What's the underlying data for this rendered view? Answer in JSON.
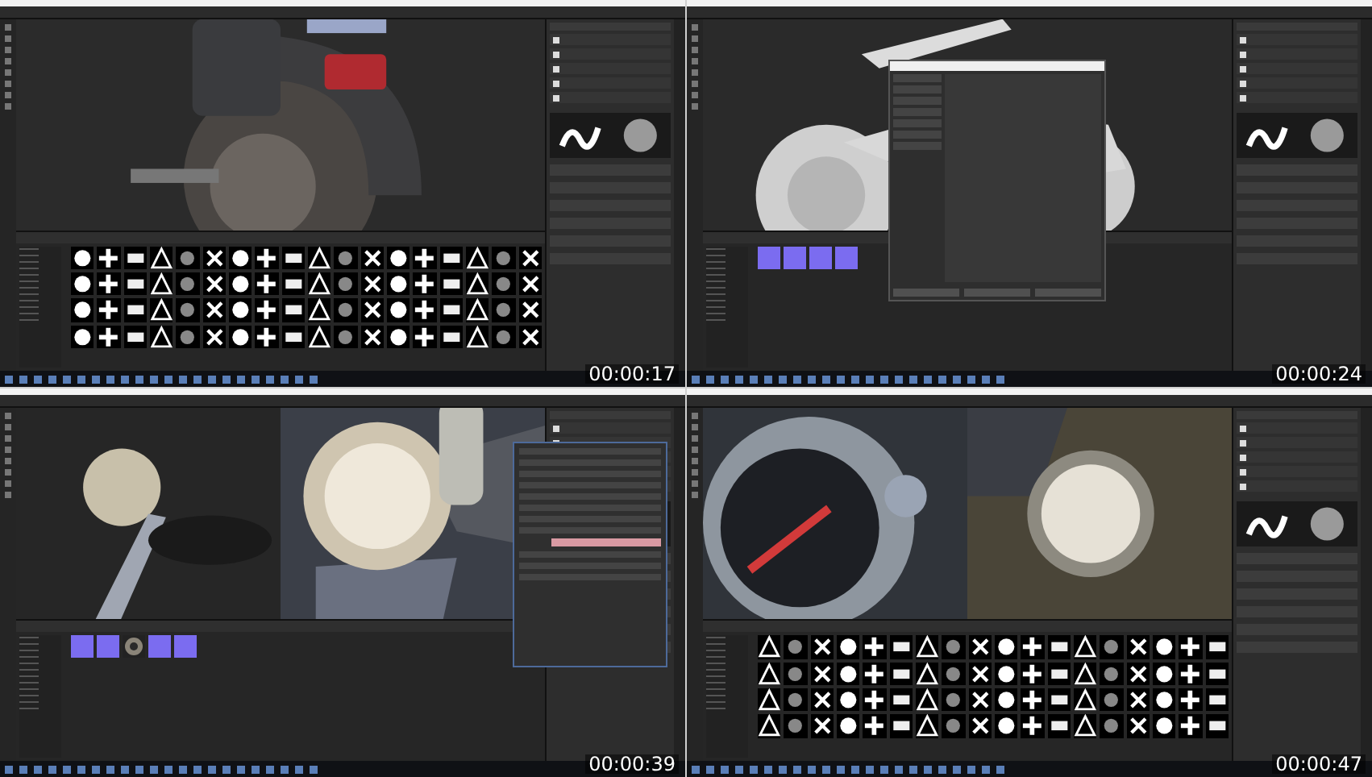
{
  "frames": [
    {
      "timestamp": "00:00:17",
      "viewport": {
        "kind": "rear"
      },
      "shelf": {
        "kind": "alphas"
      }
    },
    {
      "timestamp": "00:00:24",
      "viewport": {
        "kind": "bike"
      },
      "overlay": {
        "kind": "dialog"
      },
      "shelf": {
        "kind": "materials",
        "items": [
          {
            "kind": "swatch"
          },
          {
            "kind": "swatch"
          },
          {
            "kind": "swatch"
          },
          {
            "kind": "swatch"
          }
        ]
      }
    },
    {
      "timestamp": "00:00:39",
      "viewport": {
        "kind": "headlight"
      },
      "overlay": {
        "kind": "panel"
      },
      "shelf": {
        "kind": "materials",
        "items": [
          {
            "kind": "swatch"
          },
          {
            "kind": "swatch"
          },
          {
            "kind": "sphere"
          },
          {
            "kind": "swatch"
          },
          {
            "kind": "swatch"
          }
        ]
      }
    },
    {
      "timestamp": "00:00:47",
      "viewport": {
        "kind": "gauge"
      },
      "shelf": {
        "kind": "alphas"
      }
    }
  ]
}
